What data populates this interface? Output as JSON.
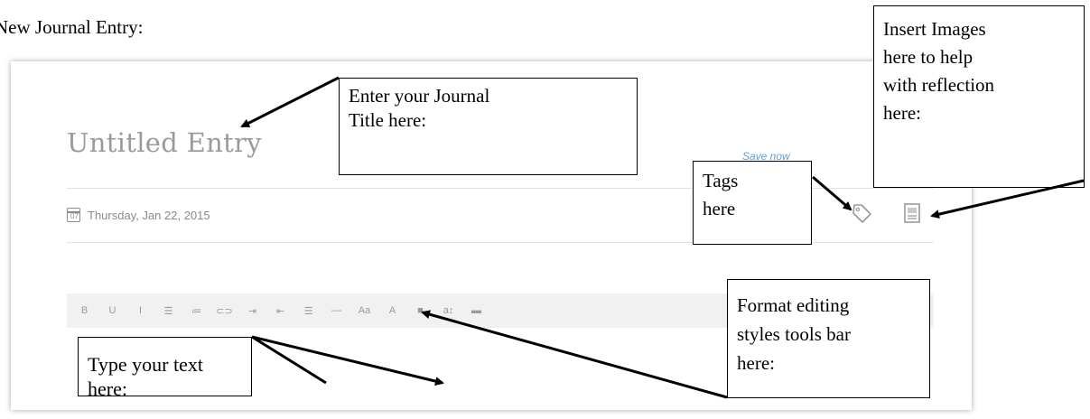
{
  "heading": "New Journal Entry:",
  "editor": {
    "title_placeholder": "Untitled Entry",
    "save_label": "Save now",
    "date": "Thursday, Jan 22, 2015",
    "calendar_day": "07",
    "toolbar": [
      {
        "name": "bold",
        "label": "B"
      },
      {
        "name": "underline",
        "label": "U"
      },
      {
        "name": "italic",
        "label": "I"
      },
      {
        "name": "bullet-list",
        "label": "☰"
      },
      {
        "name": "numbered-list",
        "label": "≔"
      },
      {
        "name": "link",
        "label": "⊂⊃"
      },
      {
        "name": "indent",
        "label": "⇥"
      },
      {
        "name": "outdent",
        "label": "⇤"
      },
      {
        "name": "align",
        "label": "☰"
      },
      {
        "name": "horizontal-rule",
        "label": "—"
      },
      {
        "name": "font-size",
        "label": "Aa"
      },
      {
        "name": "text-color",
        "label": "A"
      },
      {
        "name": "highlight-color",
        "label": "■"
      },
      {
        "name": "line-height",
        "label": "a↕"
      },
      {
        "name": "insert-image",
        "label": "▬"
      }
    ],
    "icons": {
      "tag": "tag-icon",
      "image": "image-icon",
      "calendar": "calendar-icon"
    },
    "accent": "#5fa3d6"
  },
  "callouts": {
    "title": [
      "Enter your Journal",
      "Title here:"
    ],
    "insert_images": [
      "Insert Images",
      "here to help",
      "with reflection",
      "here:"
    ],
    "tags": [
      "Tags",
      "here"
    ],
    "format": [
      "Format editing",
      "styles tools bar",
      "here:"
    ],
    "type_text": [
      "Type your text here:"
    ]
  }
}
